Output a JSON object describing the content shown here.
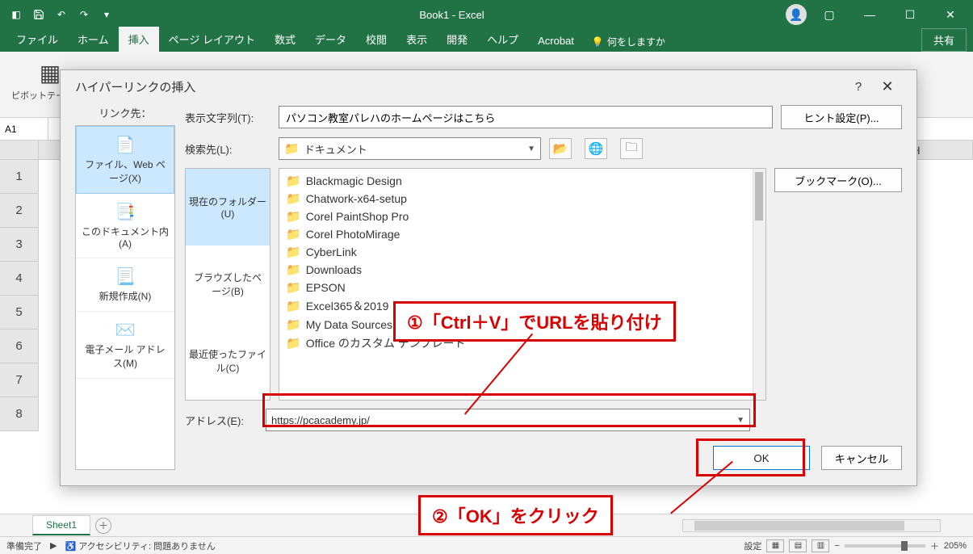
{
  "titlebar": {
    "app_title": "Book1  -  Excel"
  },
  "ribbon": {
    "tabs": {
      "file": "ファイル",
      "home": "ホーム",
      "insert": "挿入",
      "page_layout": "ページ レイアウト",
      "formulas": "数式",
      "data": "データ",
      "review": "校閲",
      "view": "表示",
      "developer": "開発",
      "help": "ヘルプ",
      "acrobat": "Acrobat"
    },
    "tellme_placeholder": "何をしますか",
    "share": "共有",
    "group_pivot": "ピボットテーブル ▾"
  },
  "namebox": {
    "cell": "A1"
  },
  "columns": {
    "H": "H"
  },
  "rows": [
    "1",
    "2",
    "3",
    "4",
    "5",
    "6",
    "7",
    "8"
  ],
  "sheets": {
    "sheet1": "Sheet1"
  },
  "status": {
    "ready": "準備完了",
    "accessibility": "アクセシビリティ: 問題ありません",
    "display_settings": "設定",
    "zoom": "205%"
  },
  "dialog": {
    "title": "ハイパーリンクの挿入",
    "link_to_label": "リンク先：",
    "link_opts": {
      "file_web": "ファイル、Web ページ(X)",
      "this_doc": "このドキュメント内(A)",
      "new_doc": "新規作成(N)",
      "email": "電子メール アドレス(M)"
    },
    "text_to_display_label": "表示文字列(T):",
    "text_to_display_value": "パソコン教室パレハのホームページはこちら",
    "look_in_label": "検索先(L):",
    "look_in_value": "ドキュメント",
    "browse_tabs": {
      "current": "現在のフォルダー(U)",
      "browsed": "ブラウズしたページ(B)",
      "recent": "最近使ったファイル(C)"
    },
    "files": [
      "Blackmagic Design",
      "Chatwork-x64-setup",
      "Corel PaintShop Pro",
      "Corel PhotoMirage",
      "CyberLink",
      "Downloads",
      "EPSON",
      "Excel365＆2019",
      "My Data Sources",
      "Office のカスタム テンプレート"
    ],
    "address_label": "アドレス(E):",
    "address_value": "https://pcacademy.jp/",
    "screentip_btn": "ヒント設定(P)...",
    "bookmark_btn": "ブックマーク(O)...",
    "ok": "OK",
    "cancel": "キャンセル"
  },
  "annotations": {
    "step1": "①「Ctrl＋V」でURLを貼り付け",
    "step2": "②「OK」をクリック"
  }
}
